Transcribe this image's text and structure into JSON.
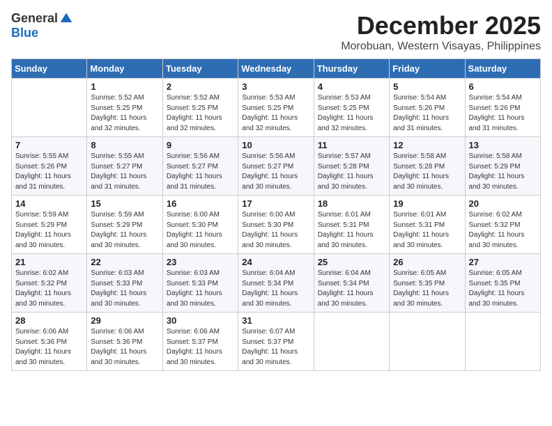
{
  "logo": {
    "general": "General",
    "blue": "Blue"
  },
  "title": {
    "month": "December 2025",
    "location": "Morobuan, Western Visayas, Philippines"
  },
  "weekdays": [
    "Sunday",
    "Monday",
    "Tuesday",
    "Wednesday",
    "Thursday",
    "Friday",
    "Saturday"
  ],
  "weeks": [
    [
      {
        "day": "",
        "info": ""
      },
      {
        "day": "1",
        "info": "Sunrise: 5:52 AM\nSunset: 5:25 PM\nDaylight: 11 hours\nand 32 minutes."
      },
      {
        "day": "2",
        "info": "Sunrise: 5:52 AM\nSunset: 5:25 PM\nDaylight: 11 hours\nand 32 minutes."
      },
      {
        "day": "3",
        "info": "Sunrise: 5:53 AM\nSunset: 5:25 PM\nDaylight: 11 hours\nand 32 minutes."
      },
      {
        "day": "4",
        "info": "Sunrise: 5:53 AM\nSunset: 5:25 PM\nDaylight: 11 hours\nand 32 minutes."
      },
      {
        "day": "5",
        "info": "Sunrise: 5:54 AM\nSunset: 5:26 PM\nDaylight: 11 hours\nand 31 minutes."
      },
      {
        "day": "6",
        "info": "Sunrise: 5:54 AM\nSunset: 5:26 PM\nDaylight: 11 hours\nand 31 minutes."
      }
    ],
    [
      {
        "day": "7",
        "info": "Sunrise: 5:55 AM\nSunset: 5:26 PM\nDaylight: 11 hours\nand 31 minutes."
      },
      {
        "day": "8",
        "info": "Sunrise: 5:55 AM\nSunset: 5:27 PM\nDaylight: 11 hours\nand 31 minutes."
      },
      {
        "day": "9",
        "info": "Sunrise: 5:56 AM\nSunset: 5:27 PM\nDaylight: 11 hours\nand 31 minutes."
      },
      {
        "day": "10",
        "info": "Sunrise: 5:56 AM\nSunset: 5:27 PM\nDaylight: 11 hours\nand 30 minutes."
      },
      {
        "day": "11",
        "info": "Sunrise: 5:57 AM\nSunset: 5:28 PM\nDaylight: 11 hours\nand 30 minutes."
      },
      {
        "day": "12",
        "info": "Sunrise: 5:58 AM\nSunset: 5:28 PM\nDaylight: 11 hours\nand 30 minutes."
      },
      {
        "day": "13",
        "info": "Sunrise: 5:58 AM\nSunset: 5:29 PM\nDaylight: 11 hours\nand 30 minutes."
      }
    ],
    [
      {
        "day": "14",
        "info": "Sunrise: 5:59 AM\nSunset: 5:29 PM\nDaylight: 11 hours\nand 30 minutes."
      },
      {
        "day": "15",
        "info": "Sunrise: 5:59 AM\nSunset: 5:29 PM\nDaylight: 11 hours\nand 30 minutes."
      },
      {
        "day": "16",
        "info": "Sunrise: 6:00 AM\nSunset: 5:30 PM\nDaylight: 11 hours\nand 30 minutes."
      },
      {
        "day": "17",
        "info": "Sunrise: 6:00 AM\nSunset: 5:30 PM\nDaylight: 11 hours\nand 30 minutes."
      },
      {
        "day": "18",
        "info": "Sunrise: 6:01 AM\nSunset: 5:31 PM\nDaylight: 11 hours\nand 30 minutes."
      },
      {
        "day": "19",
        "info": "Sunrise: 6:01 AM\nSunset: 5:31 PM\nDaylight: 11 hours\nand 30 minutes."
      },
      {
        "day": "20",
        "info": "Sunrise: 6:02 AM\nSunset: 5:32 PM\nDaylight: 11 hours\nand 30 minutes."
      }
    ],
    [
      {
        "day": "21",
        "info": "Sunrise: 6:02 AM\nSunset: 5:32 PM\nDaylight: 11 hours\nand 30 minutes."
      },
      {
        "day": "22",
        "info": "Sunrise: 6:03 AM\nSunset: 5:33 PM\nDaylight: 11 hours\nand 30 minutes."
      },
      {
        "day": "23",
        "info": "Sunrise: 6:03 AM\nSunset: 5:33 PM\nDaylight: 11 hours\nand 30 minutes."
      },
      {
        "day": "24",
        "info": "Sunrise: 6:04 AM\nSunset: 5:34 PM\nDaylight: 11 hours\nand 30 minutes."
      },
      {
        "day": "25",
        "info": "Sunrise: 6:04 AM\nSunset: 5:34 PM\nDaylight: 11 hours\nand 30 minutes."
      },
      {
        "day": "26",
        "info": "Sunrise: 6:05 AM\nSunset: 5:35 PM\nDaylight: 11 hours\nand 30 minutes."
      },
      {
        "day": "27",
        "info": "Sunrise: 6:05 AM\nSunset: 5:35 PM\nDaylight: 11 hours\nand 30 minutes."
      }
    ],
    [
      {
        "day": "28",
        "info": "Sunrise: 6:06 AM\nSunset: 5:36 PM\nDaylight: 11 hours\nand 30 minutes."
      },
      {
        "day": "29",
        "info": "Sunrise: 6:06 AM\nSunset: 5:36 PM\nDaylight: 11 hours\nand 30 minutes."
      },
      {
        "day": "30",
        "info": "Sunrise: 6:06 AM\nSunset: 5:37 PM\nDaylight: 11 hours\nand 30 minutes."
      },
      {
        "day": "31",
        "info": "Sunrise: 6:07 AM\nSunset: 5:37 PM\nDaylight: 11 hours\nand 30 minutes."
      },
      {
        "day": "",
        "info": ""
      },
      {
        "day": "",
        "info": ""
      },
      {
        "day": "",
        "info": ""
      }
    ]
  ]
}
